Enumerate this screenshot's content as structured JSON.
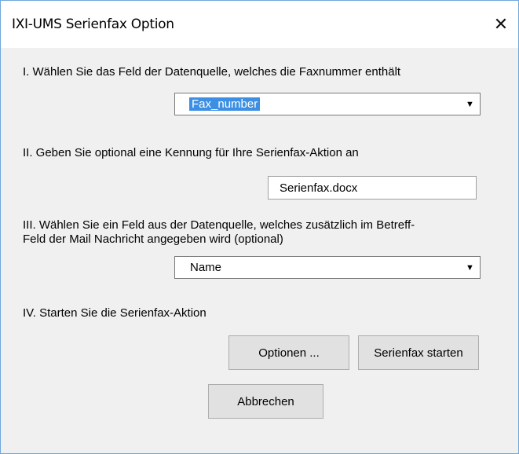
{
  "window": {
    "title": "IXI-UMS Serienfax Option",
    "close_icon": "close-icon"
  },
  "step1": {
    "label": "I. Wählen Sie das Feld der Datenquelle, welches die Faxnummer enthält",
    "selected": "Fax_number"
  },
  "step2": {
    "label": "II. Geben Sie optional eine Kennung für Ihre Serienfax-Aktion an",
    "value": "Serienfax.docx"
  },
  "step3": {
    "label_line1": "III. Wählen Sie ein Feld aus der Datenquelle, welches zusätzlich im Betreff-",
    "label_line2": "Feld der Mail Nachricht angegeben wird (optional)",
    "selected": "Name"
  },
  "step4": {
    "label": "IV. Starten Sie die Serienfax-Aktion",
    "options_button": "Optionen ...",
    "start_button": "Serienfax starten"
  },
  "cancel_button": "Abbrechen",
  "colors": {
    "selection_highlight": "#3d8fe4",
    "window_border": "#6fa8dc",
    "dialog_background": "#f0f0f0"
  }
}
